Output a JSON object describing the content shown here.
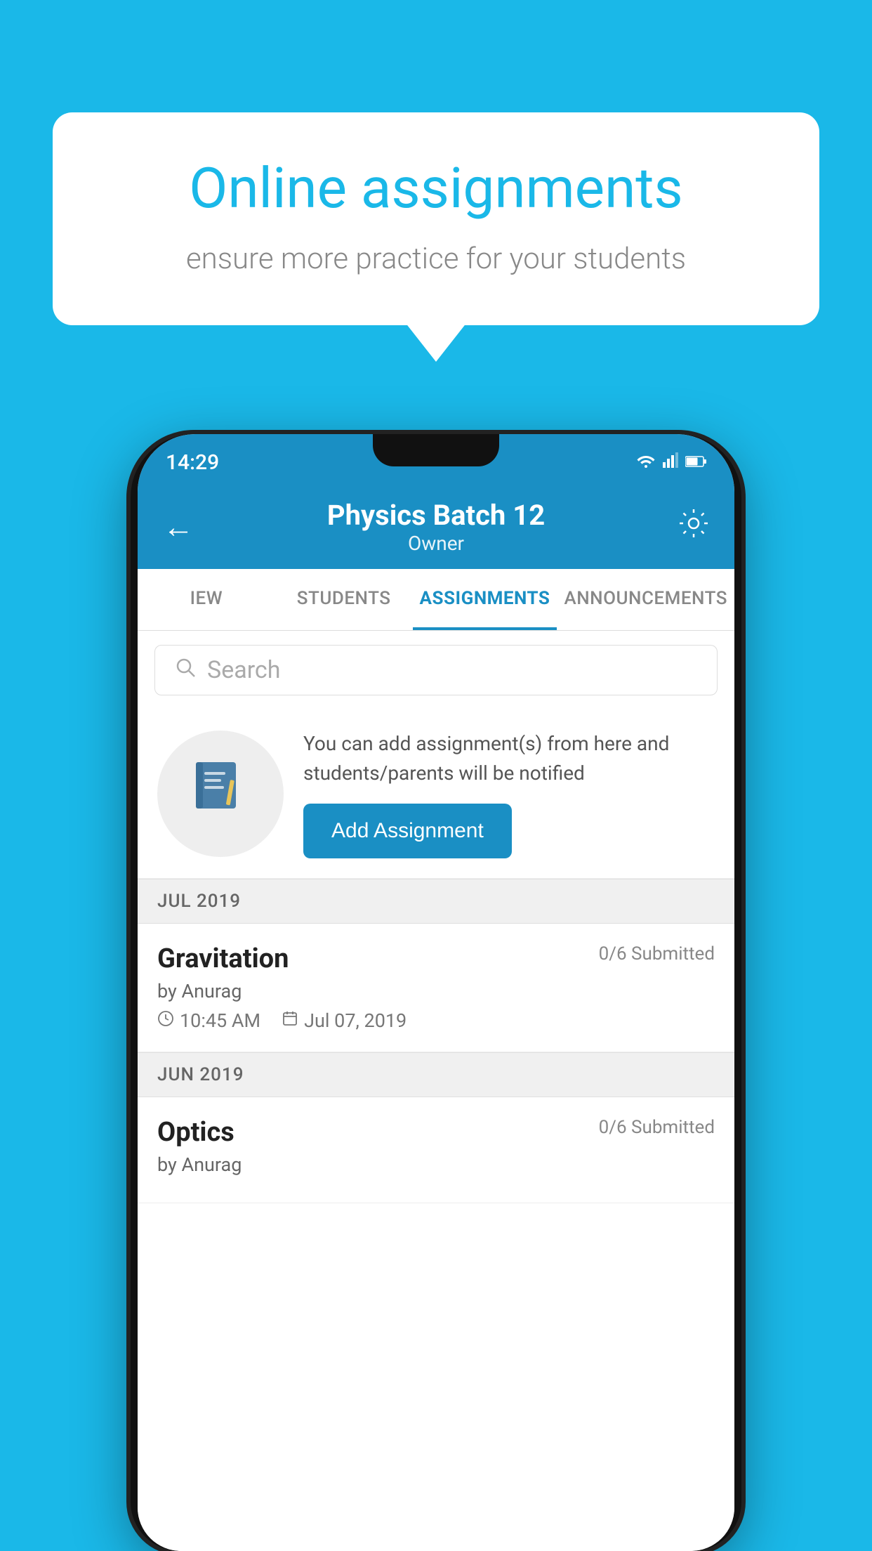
{
  "background_color": "#1ab8e8",
  "bubble": {
    "title": "Online assignments",
    "subtitle": "ensure more practice for your students"
  },
  "status_bar": {
    "time": "14:29",
    "wifi": "▾",
    "signal": "▲",
    "battery": "▮"
  },
  "header": {
    "title": "Physics Batch 12",
    "subtitle": "Owner",
    "back_label": "←",
    "gear_label": "⚙"
  },
  "tabs": [
    {
      "label": "IEW",
      "active": false
    },
    {
      "label": "STUDENTS",
      "active": false
    },
    {
      "label": "ASSIGNMENTS",
      "active": true
    },
    {
      "label": "ANNOUNCEMENTS",
      "active": false
    }
  ],
  "search": {
    "placeholder": "Search"
  },
  "promo": {
    "description": "You can add assignment(s) from here and students/parents will be notified",
    "button_label": "Add Assignment"
  },
  "month_groups": [
    {
      "month": "JUL 2019",
      "assignments": [
        {
          "title": "Gravitation",
          "submitted": "0/6 Submitted",
          "author": "by Anurag",
          "time": "10:45 AM",
          "date": "Jul 07, 2019"
        }
      ]
    },
    {
      "month": "JUN 2019",
      "assignments": [
        {
          "title": "Optics",
          "submitted": "0/6 Submitted",
          "author": "by Anurag",
          "time": "",
          "date": ""
        }
      ]
    }
  ]
}
